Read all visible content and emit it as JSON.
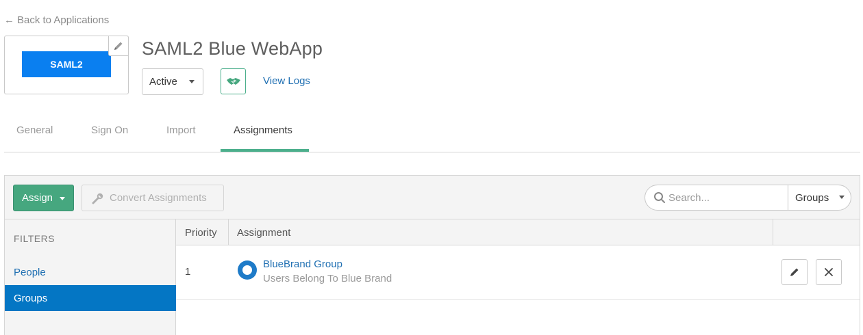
{
  "nav": {
    "back_label": "Back to Applications",
    "back_arrow": "←"
  },
  "app": {
    "logo_text": "SAML2",
    "logo_color": "#0a7ff0",
    "title": "SAML2 Blue WebApp",
    "status": "Active",
    "view_logs": "View Logs"
  },
  "tabs": [
    {
      "label": "General",
      "active": false
    },
    {
      "label": "Sign On",
      "active": false
    },
    {
      "label": "Import",
      "active": false
    },
    {
      "label": "Assignments",
      "active": true
    }
  ],
  "toolbar": {
    "assign_label": "Assign",
    "convert_label": "Convert Assignments",
    "search_placeholder": "Search...",
    "search_type": "Groups"
  },
  "filters": {
    "heading": "FILTERS",
    "items": [
      {
        "label": "People",
        "selected": false
      },
      {
        "label": "Groups",
        "selected": true
      }
    ]
  },
  "table": {
    "columns": [
      "Priority",
      "Assignment"
    ],
    "rows": [
      {
        "priority": "1",
        "name": "BlueBrand Group",
        "description": "Users Belong To Blue Brand"
      }
    ]
  },
  "colors": {
    "accent_green": "#46a77f",
    "link_blue": "#1f6fb2",
    "selected_blue": "#0476c4"
  },
  "icons": [
    "pencil-icon",
    "handshake-icon",
    "caret-down-icon",
    "wrench-icon",
    "search-icon",
    "group-icon",
    "close-icon"
  ]
}
